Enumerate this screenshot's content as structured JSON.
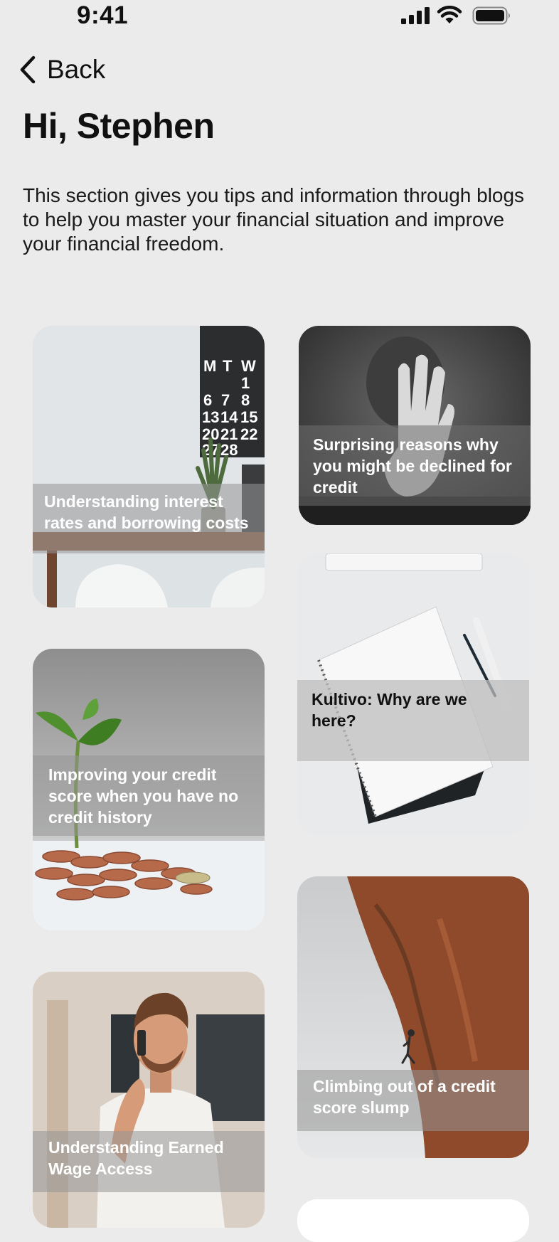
{
  "status": {
    "time": "9:41"
  },
  "header": {
    "back_label": "Back",
    "title": "Hi, Stephen"
  },
  "intro": "This section gives you tips and information through blogs to help you master your financial situation and improve your financial freedom.",
  "cards": [
    {
      "title": "Understanding interest rates and borrowing costs"
    },
    {
      "title": "Surprising reasons why you might be declined for credit"
    },
    {
      "title": "Kultivo: Why are we here?"
    },
    {
      "title": "Improving your credit score when you have no credit history"
    },
    {
      "title": "Climbing out of a credit score slump"
    },
    {
      "title": "Understanding Earned Wage Access"
    }
  ],
  "calendar": {
    "headers": [
      "M",
      "T",
      "W"
    ],
    "rows": [
      [
        "",
        "",
        "1"
      ],
      [
        "6",
        "7",
        "8"
      ],
      [
        "13",
        "14",
        "15"
      ],
      [
        "20",
        "21",
        "22"
      ],
      [
        "27",
        "28",
        ""
      ]
    ]
  },
  "icons": [
    "chevron-left-icon",
    "signal-icon",
    "wifi-icon",
    "battery-icon"
  ]
}
